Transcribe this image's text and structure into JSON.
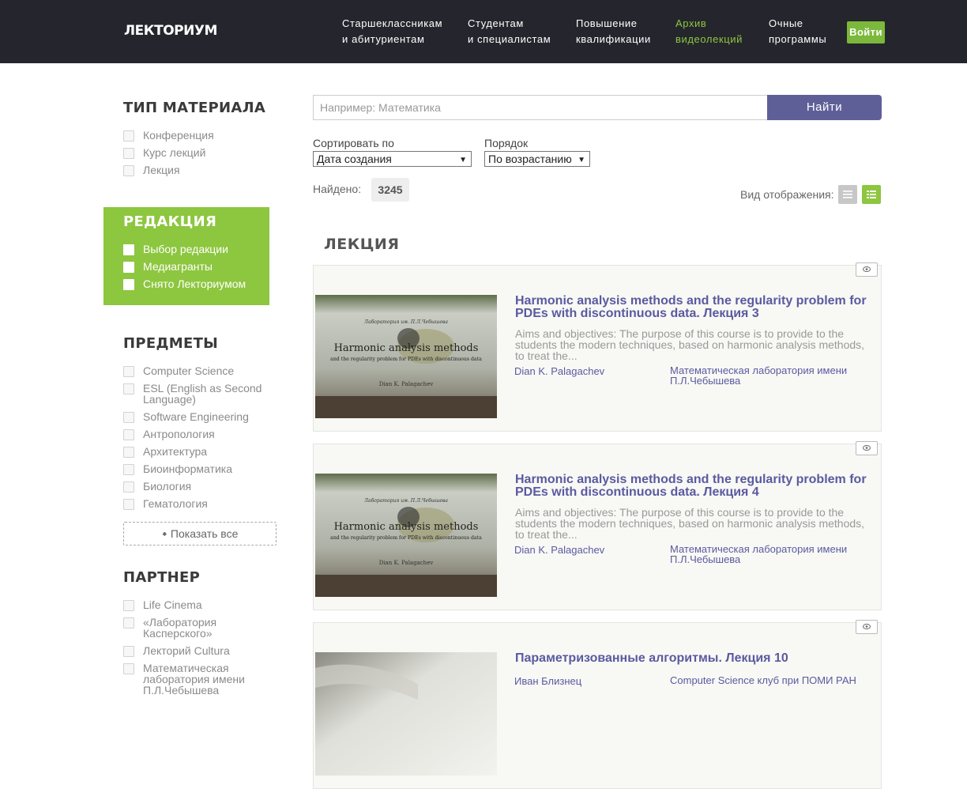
{
  "header": {
    "logo": "ЛЕКТОРИУМ",
    "nav": [
      {
        "label": "Старшеклассникам\nи абитуриентам",
        "active": false
      },
      {
        "label": "Студентам\nи специалистам",
        "active": false
      },
      {
        "label": "Повышение\nквалификации",
        "active": false
      },
      {
        "label": "Архив\nвидеолекций",
        "active": true
      },
      {
        "label": "Очные\nпрограммы",
        "active": false
      }
    ],
    "login_label": "Войти"
  },
  "sidebar": {
    "material": {
      "title": "ТИП МАТЕРИАЛА",
      "items": [
        "Конференция",
        "Курс лекций",
        "Лекция"
      ]
    },
    "editorial": {
      "title": "РЕДАКЦИЯ",
      "items": [
        "Выбор редакции",
        "Медиагранты",
        "Снято Лекториумом"
      ]
    },
    "subjects": {
      "title": "ПРЕДМЕТЫ",
      "items": [
        "Computer Science",
        "ESL (English as Second Language)",
        "Software Engineering",
        "Антропология",
        "Архитектура",
        "Биоинформатика",
        "Биология",
        "Гематология"
      ],
      "show_all": "Показать все"
    },
    "partner": {
      "title": "ПАРТНЕР",
      "items": [
        "Life Cinema",
        "«Лаборатория Касперского»",
        "Лекторий Cultura",
        "Математическая лаборатория имени П.Л.Чебышева"
      ]
    }
  },
  "search": {
    "placeholder": "Например: Математика",
    "button": "Найти"
  },
  "sort": {
    "label": "Сортировать по",
    "value": "Дата создания",
    "order_label": "Порядок",
    "order_value": "По возрастанию"
  },
  "results": {
    "found_label": "Найдено:",
    "count": "3245",
    "view_label": "Вид отображения:",
    "section_title": "ЛЕКЦИЯ"
  },
  "thumb": {
    "lab": "Лаборатория им. П.Л.Чебышева",
    "title": "Harmonic analysis methods",
    "subtitle": "and the regularity problem for PDEs with discontinuous data",
    "author": "Dian K. Palagachev"
  },
  "cards": [
    {
      "title": "Harmonic analysis methods and the regularity problem for PDEs with discontinuous data. Лекция 3",
      "desc": "Aims and objectives: The purpose of this course is to provide to the students the modern techniques, based on harmonic analysis methods, to treat the...",
      "author": "Dian K. Palagachev",
      "org": "Математическая лаборатория имени П.Л.Чебышева"
    },
    {
      "title": "Harmonic analysis methods and the regularity problem for PDEs with discontinuous data. Лекция 4",
      "desc": "Aims and objectives: The purpose of this course is to provide to the students the modern techniques, based on harmonic analysis methods, to treat the...",
      "author": "Dian K. Palagachev",
      "org": "Математическая лаборатория имени П.Л.Чебышева"
    },
    {
      "title": "Параметризованные алгоритмы. Лекция 10",
      "desc": "",
      "author": "Иван Близнец",
      "org": "Computer Science клуб при ПОМИ РАН"
    }
  ],
  "colors": {
    "header_bg": "#25262d",
    "accent_green": "#8dc63f",
    "accent_purple": "#5f5f98"
  }
}
